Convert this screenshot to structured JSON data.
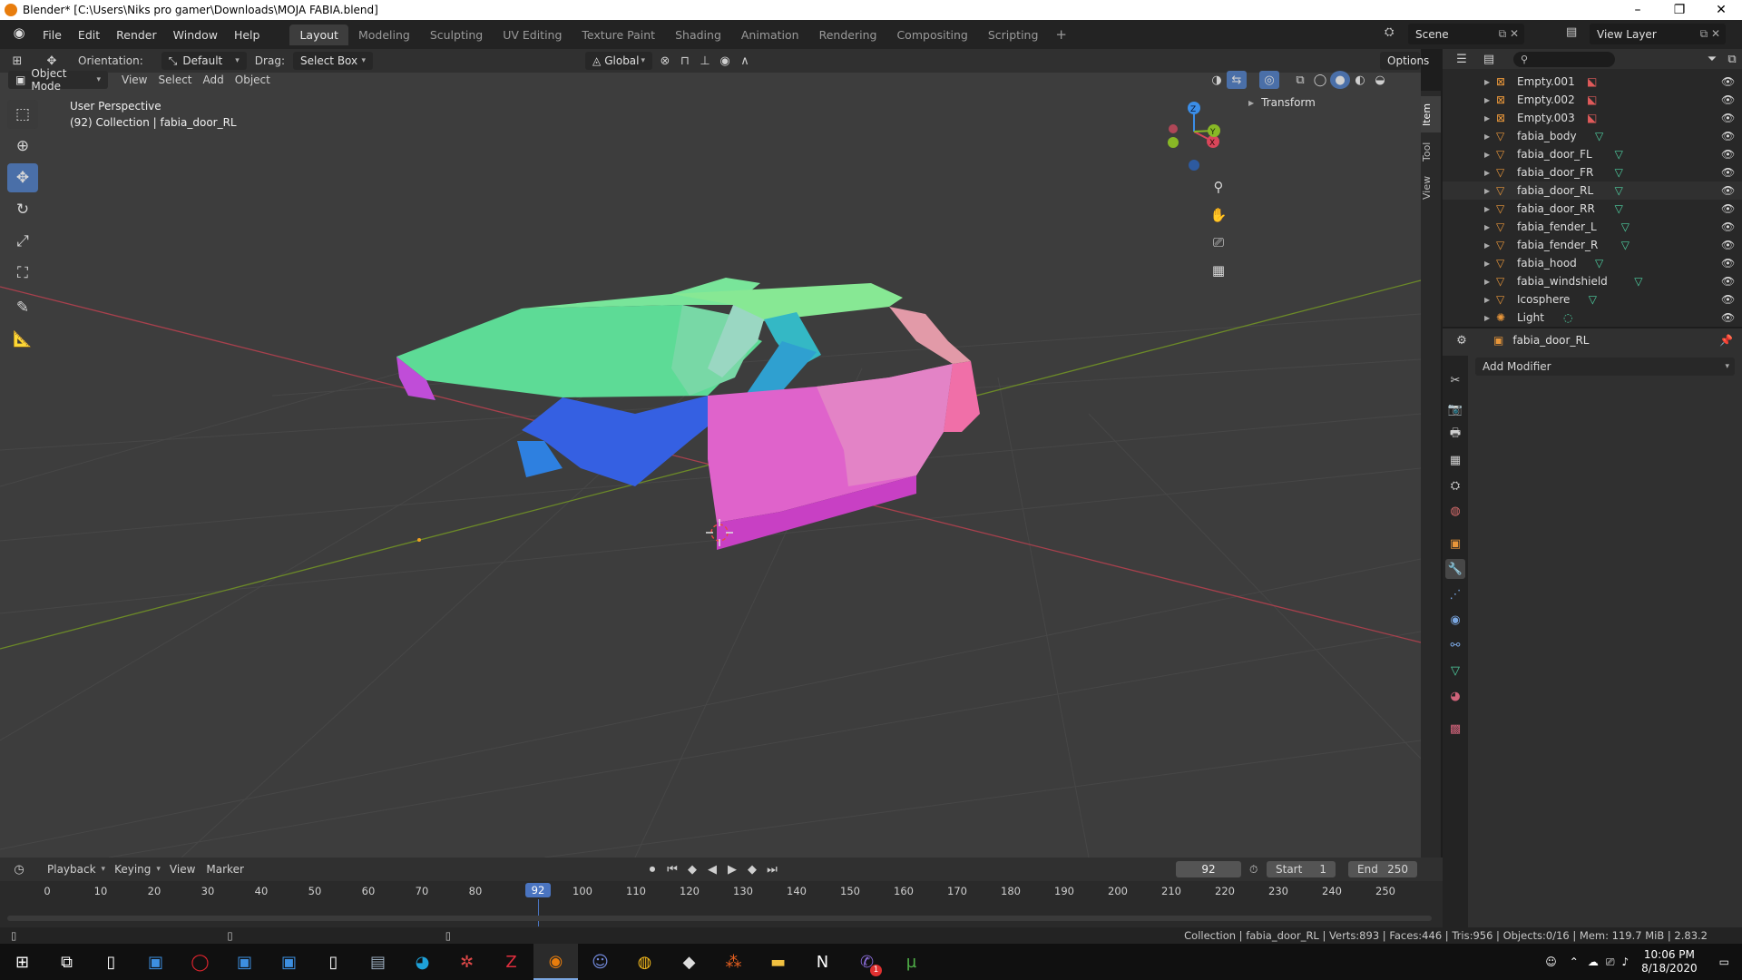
{
  "window": {
    "title": "Blender* [C:\\Users\\Niks pro gamer\\Downloads\\MOJA FABIA.blend]",
    "controls": [
      "–",
      "❐",
      "✕"
    ]
  },
  "menu": [
    "File",
    "Edit",
    "Render",
    "Window",
    "Help"
  ],
  "workspaces": [
    {
      "label": "Layout",
      "active": true
    },
    {
      "label": "Modeling"
    },
    {
      "label": "Sculpting"
    },
    {
      "label": "UV Editing"
    },
    {
      "label": "Texture Paint"
    },
    {
      "label": "Shading"
    },
    {
      "label": "Animation"
    },
    {
      "label": "Rendering"
    },
    {
      "label": "Compositing"
    },
    {
      "label": "Scripting"
    }
  ],
  "scene": {
    "label": "Scene"
  },
  "view_layer": {
    "label": "View Layer"
  },
  "toolheader": {
    "orientation_label": "Orientation:",
    "orientation_value": "Default",
    "drag_label": "Drag:",
    "drag_value": "Select Box",
    "transform_orientation": "Global",
    "options": "Options"
  },
  "viewheader": {
    "mode": "Object Mode",
    "menus": [
      "View",
      "Select",
      "Add",
      "Object"
    ]
  },
  "viewport": {
    "perspective": "User Perspective",
    "collection_info": "(92) Collection | fabia_door_RL",
    "npanel_section": "Transform",
    "side_tabs": [
      "Item",
      "Tool",
      "View"
    ],
    "gizmo_axes": {
      "x": "X",
      "y": "Y",
      "z": "Z"
    }
  },
  "outliner": {
    "rows": [
      {
        "name": "Empty.001",
        "data_icon": "empty"
      },
      {
        "name": "Empty.002",
        "data_icon": "empty"
      },
      {
        "name": "Empty.003",
        "data_icon": "empty"
      },
      {
        "name": "fabia_body",
        "data_icon": "mesh"
      },
      {
        "name": "fabia_door_FL",
        "data_icon": "mesh"
      },
      {
        "name": "fabia_door_FR",
        "data_icon": "mesh"
      },
      {
        "name": "fabia_door_RL",
        "data_icon": "mesh",
        "selected": true
      },
      {
        "name": "fabia_door_RR",
        "data_icon": "mesh"
      },
      {
        "name": "fabia_fender_L",
        "data_icon": "mesh"
      },
      {
        "name": "fabia_fender_R",
        "data_icon": "mesh"
      },
      {
        "name": "fabia_hood",
        "data_icon": "mesh"
      },
      {
        "name": "fabia_windshield",
        "data_icon": "mesh"
      },
      {
        "name": "Icosphere",
        "data_icon": "mesh"
      },
      {
        "name": "Light",
        "data_icon": "light"
      }
    ]
  },
  "properties": {
    "object_name": "fabia_door_RL",
    "add_modifier": "Add Modifier"
  },
  "timeline": {
    "menus": [
      "Playback",
      "Keying",
      "View",
      "Marker"
    ],
    "current_frame": "92",
    "start_label": "Start",
    "start_value": "1",
    "end_label": "End",
    "end_value": "250",
    "ticks": [
      "0",
      "10",
      "20",
      "30",
      "40",
      "50",
      "60",
      "70",
      "80",
      "9",
      "100",
      "110",
      "120",
      "130",
      "140",
      "150",
      "160",
      "170",
      "180",
      "190",
      "200",
      "210",
      "220",
      "230",
      "240",
      "250"
    ]
  },
  "statusbar": {
    "text": "Collection | fabia_door_RL | Verts:893 | Faces:446 | Tris:956 | Objects:0/16 | Mem: 119.7 MiB | 2.83.2"
  },
  "taskbar": {
    "time": "10:06 PM",
    "date": "8/18/2020",
    "badge_count": "1"
  },
  "colors": {
    "accent": "#4a74c0",
    "axis_x": "#d9465a",
    "axis_y": "#88b826",
    "axis_z": "#3b8ee8",
    "mesh_icon": "#4fd1a2",
    "object_icon": "#e8963a"
  }
}
